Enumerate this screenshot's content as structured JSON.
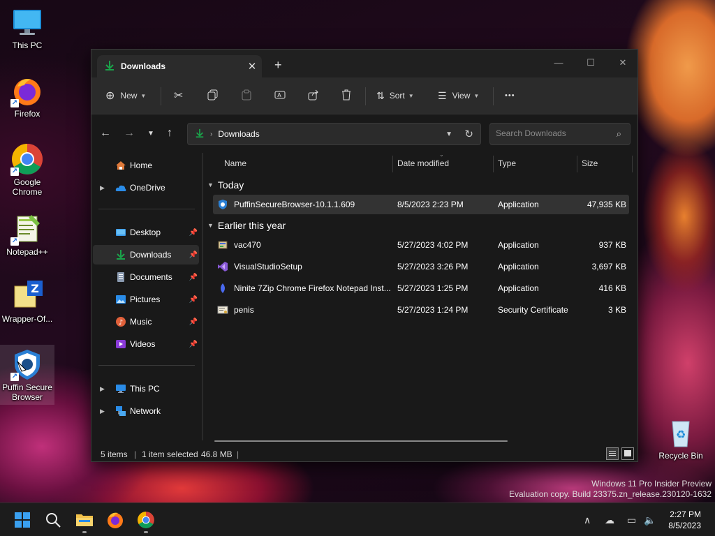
{
  "desktop": {
    "icons": [
      {
        "label": "This PC"
      },
      {
        "label": "Firefox"
      },
      {
        "label": "Google Chrome"
      },
      {
        "label": "Notepad++"
      },
      {
        "label": "Wrapper-Of..."
      },
      {
        "label": "Puffin Secure Browser"
      },
      {
        "label": "Recycle Bin"
      }
    ]
  },
  "window": {
    "tab_title": "Downloads",
    "toolbar": {
      "new_label": "New",
      "sort_label": "Sort",
      "view_label": "View",
      "more_label": "•••"
    },
    "address": {
      "crumb": "Downloads",
      "search_placeholder": "Search Downloads"
    },
    "nav": {
      "items": [
        {
          "label": "Home"
        },
        {
          "label": "OneDrive"
        },
        {
          "label": "Desktop"
        },
        {
          "label": "Downloads"
        },
        {
          "label": "Documents"
        },
        {
          "label": "Pictures"
        },
        {
          "label": "Music"
        },
        {
          "label": "Videos"
        },
        {
          "label": "This PC"
        },
        {
          "label": "Network"
        }
      ]
    },
    "columns": [
      "Name",
      "Date modified",
      "Type",
      "Size"
    ],
    "groups": [
      {
        "label": "Today",
        "files": [
          {
            "name": "PuffinSecureBrowser-10.1.1.609",
            "date": "8/5/2023 2:23 PM",
            "type": "Application",
            "size": "47,935 KB"
          }
        ]
      },
      {
        "label": "Earlier this year",
        "files": [
          {
            "name": "vac470",
            "date": "5/27/2023 4:02 PM",
            "type": "Application",
            "size": "937 KB"
          },
          {
            "name": "VisualStudioSetup",
            "date": "5/27/2023 3:26 PM",
            "type": "Application",
            "size": "3,697 KB"
          },
          {
            "name": "Ninite 7Zip Chrome Firefox Notepad Inst...",
            "date": "5/27/2023 1:25 PM",
            "type": "Application",
            "size": "416 KB"
          },
          {
            "name": "penis",
            "date": "5/27/2023 1:24 PM",
            "type": "Security Certificate",
            "size": "3 KB"
          }
        ]
      }
    ],
    "status": {
      "count": "5 items",
      "selection": "1 item selected",
      "selection_size": "46.8 MB"
    }
  },
  "watermark": {
    "line1": "Windows 11 Pro Insider Preview",
    "line2": "Evaluation copy. Build 23375.zn_release.230120-1632"
  },
  "taskbar": {
    "time": "2:27 PM",
    "date": "8/5/2023"
  },
  "colors": {
    "accent": "#1aa34a",
    "selection": "#333333",
    "window_bg": "#191919",
    "toolbar_bg": "#2b2b2b"
  }
}
